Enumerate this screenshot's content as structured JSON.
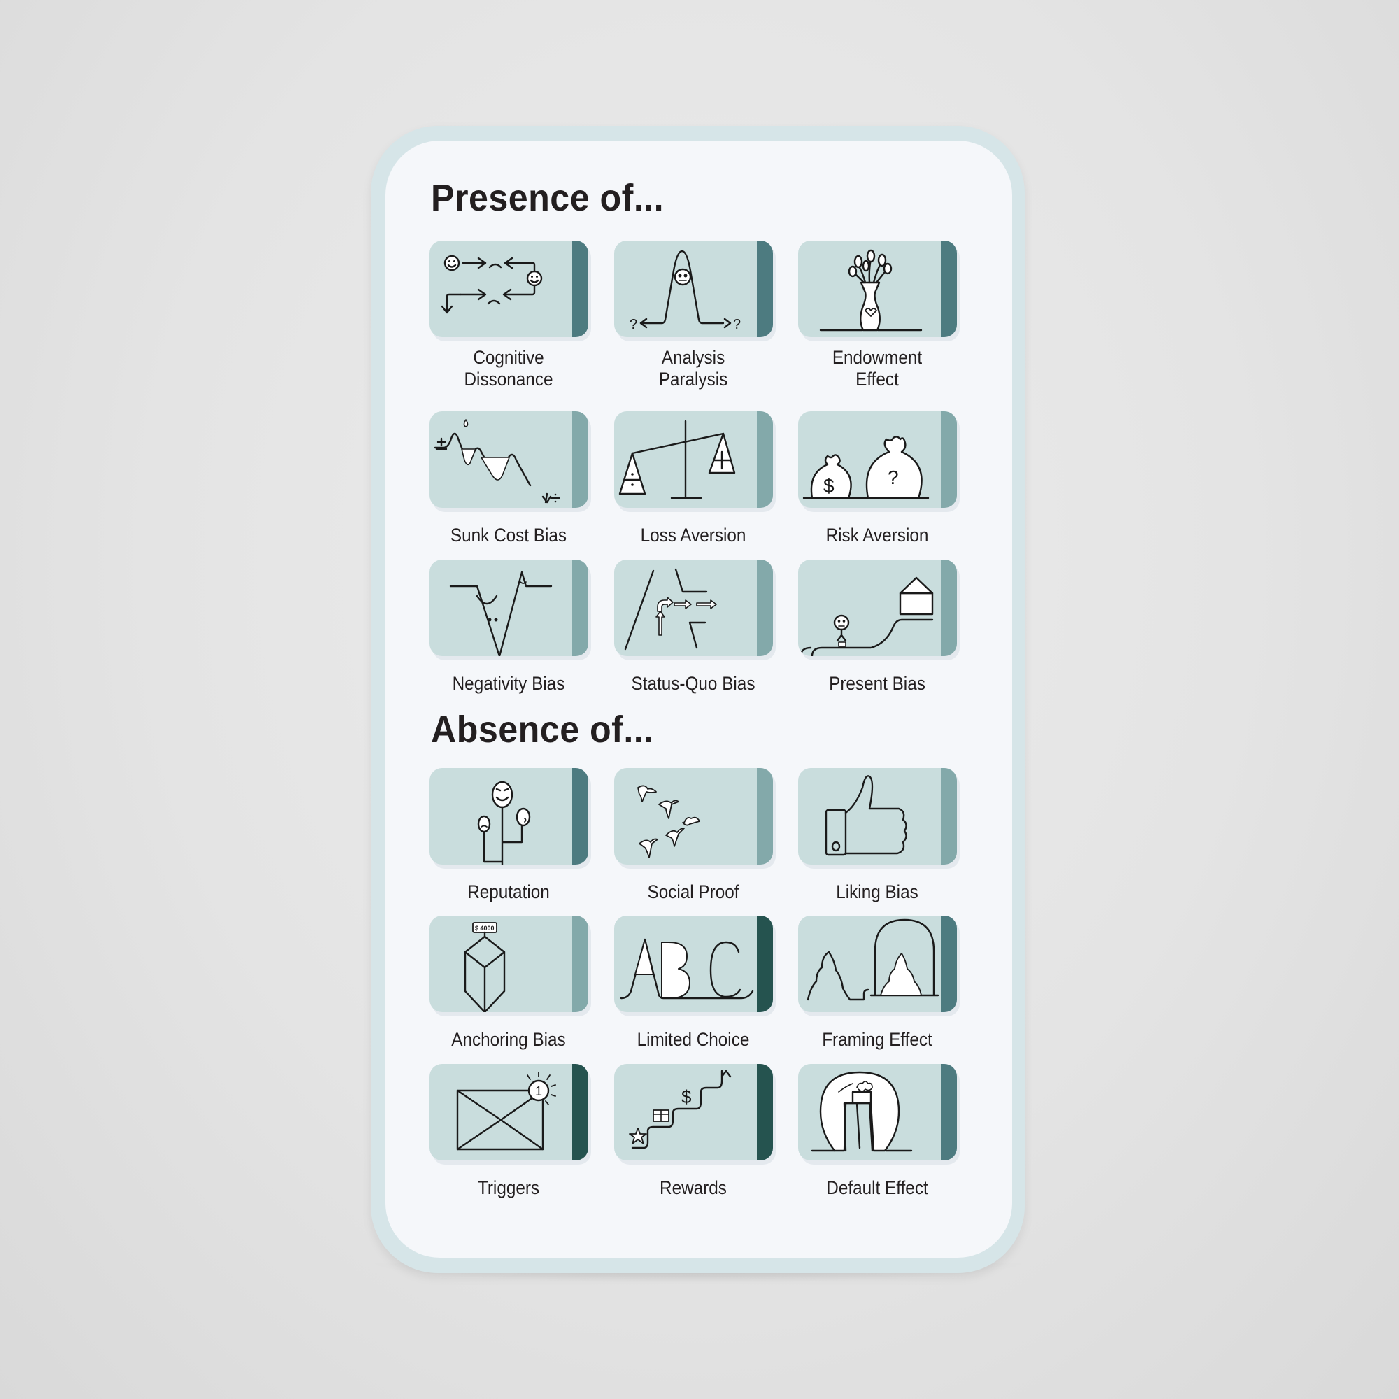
{
  "colors": {
    "tile_fill": "#c9dddd",
    "bar_light": "#83a9aa",
    "bar_dark": "#4d7b80",
    "bar_darkest": "#25534f",
    "card_border": "#d6e5e8",
    "card_fill": "#f5f7fa",
    "text": "#231f20"
  },
  "sections": [
    {
      "title": "Presence of...",
      "items": [
        {
          "label": "Cognitive Dissonance",
          "lines": [
            "Cognitive",
            "Dissonance"
          ],
          "icon": "cognitive-dissonance-icon",
          "bar": "dark"
        },
        {
          "label": "Analysis Paralysis",
          "lines": [
            "Analysis",
            "Paralysis"
          ],
          "icon": "analysis-paralysis-icon",
          "bar": "dark"
        },
        {
          "label": "Endowment Effect",
          "lines": [
            "Endowment",
            "Effect"
          ],
          "icon": "endowment-vase-icon",
          "bar": "dark"
        },
        {
          "label": "Sunk Cost Bias",
          "lines": [
            "Sunk Cost Bias"
          ],
          "icon": "sunk-cost-icon",
          "bar": "light"
        },
        {
          "label": "Loss Aversion",
          "lines": [
            "Loss Aversion"
          ],
          "icon": "balance-scale-icon",
          "bar": "light"
        },
        {
          "label": "Risk Aversion",
          "lines": [
            "Risk Aversion"
          ],
          "icon": "money-bags-icon",
          "bar": "light"
        },
        {
          "label": "Negativity Bias",
          "lines": [
            "Negativity Bias"
          ],
          "icon": "negativity-valley-icon",
          "bar": "light"
        },
        {
          "label": "Status-Quo Bias",
          "lines": [
            "Status-Quo Bias"
          ],
          "icon": "road-arrows-icon",
          "bar": "light"
        },
        {
          "label": "Present Bias",
          "lines": [
            "Present Bias"
          ],
          "icon": "path-to-house-icon",
          "bar": "light"
        }
      ]
    },
    {
      "title": "Absence of...",
      "items": [
        {
          "label": "Reputation",
          "lines": [
            "Reputation"
          ],
          "icon": "faces-tree-icon",
          "bar": "dark"
        },
        {
          "label": "Social Proof",
          "lines": [
            "Social Proof"
          ],
          "icon": "flock-birds-icon",
          "bar": "light"
        },
        {
          "label": "Liking Bias",
          "lines": [
            "Liking Bias"
          ],
          "icon": "thumbs-up-icon",
          "bar": "light"
        },
        {
          "label": "Anchoring Bias",
          "lines": [
            "Anchoring Bias"
          ],
          "icon": "price-tag-cube-icon",
          "bar": "light",
          "tag_text": "$ 4000"
        },
        {
          "label": "Limited Choice",
          "lines": [
            "Limited Choice"
          ],
          "icon": "abc-letters-icon",
          "bar": "darkest",
          "glyphs": "ABC"
        },
        {
          "label": "Framing Effect",
          "lines": [
            "Framing Effect"
          ],
          "icon": "framed-tree-icon",
          "bar": "dark"
        },
        {
          "label": "Triggers",
          "lines": [
            "Triggers"
          ],
          "icon": "envelope-notification-icon",
          "bar": "darkest",
          "badge": "1"
        },
        {
          "label": "Rewards",
          "lines": [
            "Rewards"
          ],
          "icon": "reward-stairs-icon",
          "bar": "darkest",
          "currency": "$"
        },
        {
          "label": "Default Effect",
          "lines": [
            "Default Effect"
          ],
          "icon": "spotlight-pedestal-icon",
          "bar": "dark"
        }
      ]
    }
  ]
}
